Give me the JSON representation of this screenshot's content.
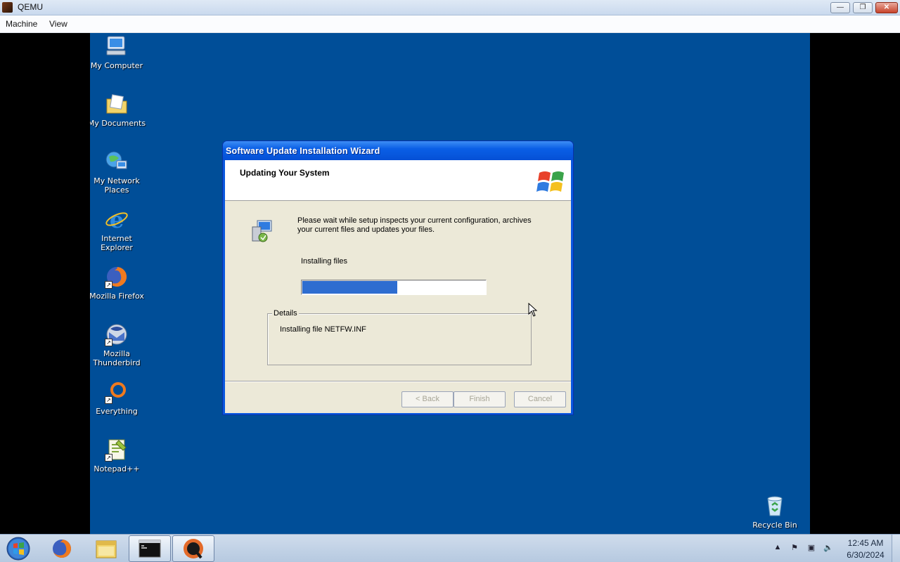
{
  "host": {
    "window_title": "QEMU",
    "menu": [
      "Machine",
      "View"
    ]
  },
  "desktop": {
    "icons": [
      {
        "label": "My Computer",
        "icon": "my-computer-icon"
      },
      {
        "label": "My Documents",
        "icon": "my-documents-icon"
      },
      {
        "label": "My Network Places",
        "icon": "my-network-places-icon"
      },
      {
        "label": "Internet Explorer",
        "icon": "internet-explorer-icon"
      },
      {
        "label": "Mozilla Firefox",
        "icon": "firefox-icon"
      },
      {
        "label": "Mozilla Thunderbird",
        "icon": "thunderbird-icon"
      },
      {
        "label": "Everything",
        "icon": "everything-search-icon"
      },
      {
        "label": "Notepad++",
        "icon": "notepad-plus-plus-icon"
      },
      {
        "label": "Recycle Bin",
        "icon": "recycle-bin-icon"
      }
    ]
  },
  "wizard": {
    "title": "Software Update Installation Wizard",
    "heading": "Updating Your System",
    "message": "Please wait while setup inspects your current configuration, archives your current files and updates your files.",
    "progress_label": "Installing files",
    "progress": 0.52,
    "details_legend": "Details",
    "details_text": "Installing file NETFW.INF",
    "buttons": {
      "back": "< Back",
      "finish": "Finish",
      "cancel": "Cancel"
    },
    "colors": {
      "titlebar": "#0a5fe6",
      "progress": "#2e6dd0",
      "body": "#ece9d8"
    }
  },
  "taskbar": {
    "items": [
      "start-orb",
      "firefox-icon",
      "file-explorer-icon",
      "command-prompt-icon",
      "qemu-icon"
    ],
    "clock_time": "12:45 AM",
    "clock_date": "6/30/2024"
  },
  "colors": {
    "desktop_bg": "#004e98"
  }
}
